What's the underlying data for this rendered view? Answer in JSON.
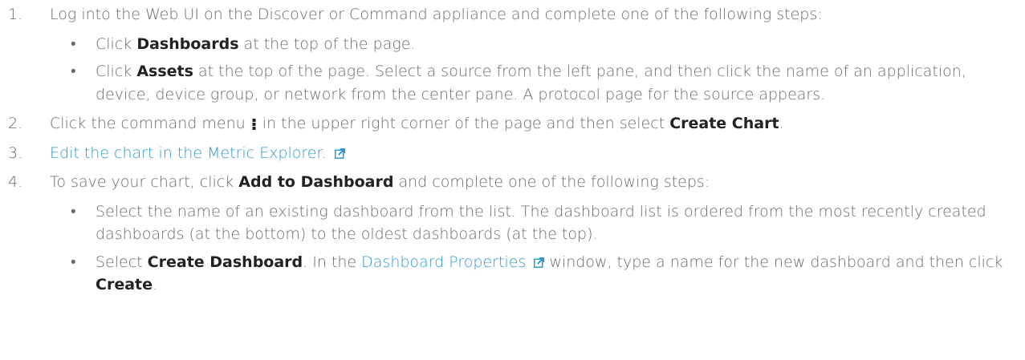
{
  "steps": [
    {
      "num": "1.",
      "text": "Log into the Web UI on the Discover or Command appliance and complete one of the following steps:"
    },
    {
      "num": "2.",
      "pre": "Click the command menu",
      "mid": "in the upper right corner of the page and then select",
      "bold": "Create Chart",
      "post": "."
    },
    {
      "num": "3.",
      "link": "Edit the chart in the Metric Explorer."
    },
    {
      "num": "4.",
      "pre": "To save your chart, click",
      "bold": "Add to Dashboard",
      "post": "and complete one of the following steps:"
    }
  ],
  "step1_bullets": [
    {
      "pre": "Click",
      "bold": "Dashboards",
      "post": "at the top of the page."
    },
    {
      "pre": "Click",
      "bold": "Assets",
      "post": "at the top of the page. Select a source from the left pane, and then click the name of an application, device, device group, or network from the center pane. A protocol page for the source appears."
    }
  ],
  "step4_bullets": [
    {
      "text": "Select the name of an existing dashboard from the list. The dashboard list is ordered from the most recently created dashboards (at the bottom) to the oldest dashboards (at the top)."
    },
    {
      "pre": "Select",
      "bold": "Create Dashboard",
      "mid": ". In the",
      "link": "Dashboard Properties",
      "post": "window, type a name for the new dashboard and then click",
      "bold2": "Create",
      "end": "."
    }
  ],
  "bullet_char": "•",
  "icons": {
    "menu": "kebab-menu-icon",
    "external": "external-link-icon"
  },
  "colors": {
    "text": "#6b6b6b",
    "bold": "#222222",
    "link": "#2e9ad0"
  }
}
